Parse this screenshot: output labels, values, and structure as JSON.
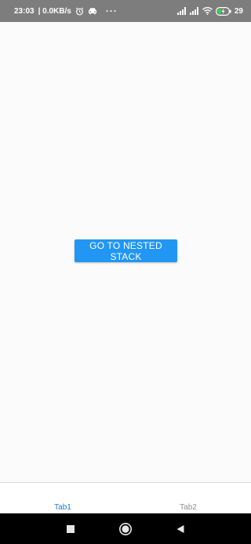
{
  "status_bar": {
    "time": "23:03",
    "network_speed": "| 0.0KB/s",
    "more_dots": "···",
    "battery_level": "29",
    "icons": [
      "alarm-icon",
      "car-icon",
      "signal-icon",
      "signal-icon",
      "wifi-icon",
      "battery-icon"
    ]
  },
  "main": {
    "button_label": "GO TO NESTED STACK",
    "accent_color": "#2196f3"
  },
  "tab_bar": {
    "tabs": [
      {
        "label": "Tab1",
        "active": true
      },
      {
        "label": "Tab2",
        "active": false
      }
    ],
    "active_color": "#1f7ad6"
  },
  "nav_bar": {
    "buttons": [
      "recents-icon",
      "home-icon",
      "back-icon"
    ]
  }
}
